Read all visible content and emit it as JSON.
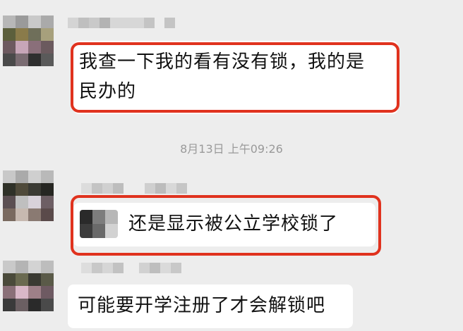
{
  "chat": {
    "messages": [
      {
        "text_line1": "我查一下我的看有没有锁，我的是",
        "text_line2": "民办的",
        "highlighted": true
      },
      {
        "text": "还是显示被公立学校锁了",
        "highlighted": true
      },
      {
        "text": "可能要开学注册了才会解锁吧",
        "highlighted": false
      }
    ],
    "timestamp": "8月13日 上午09:26"
  },
  "colors": {
    "background": "#ededed",
    "bubble": "#ffffff",
    "highlight": "#e0321e",
    "timestamp": "#9a9a9a"
  }
}
